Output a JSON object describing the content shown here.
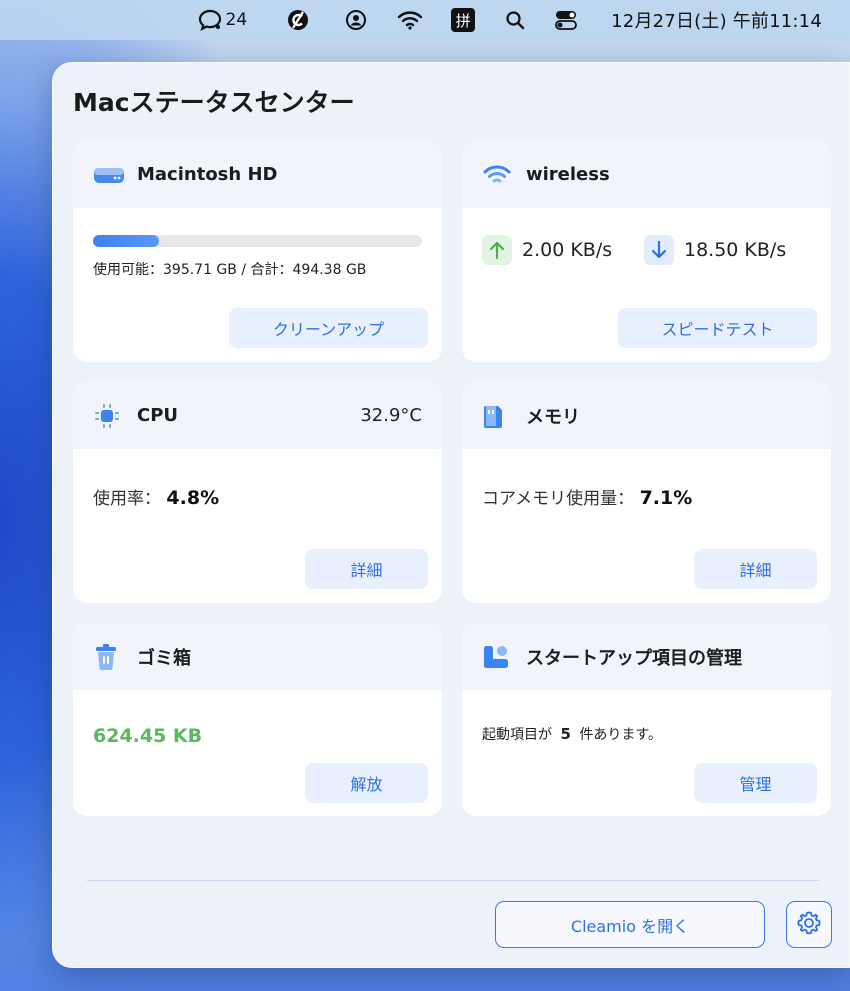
{
  "menubar": {
    "chat_count": "24",
    "input_method": "拼",
    "clock": "12月27日(土) 午前11:14"
  },
  "panel": {
    "title": "Macステータスセンター"
  },
  "disk": {
    "name": "Macintosh HD",
    "usage_text": "使用可能：395.71 GB / 合計：494.38 GB",
    "used_fraction": 0.2,
    "button": "クリーンアップ"
  },
  "network": {
    "name": "wireless",
    "upload": "2.00 KB/s",
    "download": "18.50 KB/s",
    "button": "スピードテスト"
  },
  "cpu": {
    "name": "CPU",
    "temperature": "32.9°C",
    "usage_label": "使用率：",
    "usage_value": "4.8%",
    "button": "詳細"
  },
  "memory": {
    "name": "メモリ",
    "usage_label": "コアメモリ使用量：",
    "usage_value": "7.1%",
    "button": "詳細"
  },
  "trash": {
    "name": "ゴミ箱",
    "size": "624.45  KB",
    "button": "解放"
  },
  "startup": {
    "name": "スタートアップ項目の管理",
    "text_prefix": "起動項目が",
    "count": "5",
    "text_suffix": "件あります。",
    "button": "管理"
  },
  "footer": {
    "open_button": "Cleamio を開く"
  },
  "colors": {
    "accent": "#2f6fe6",
    "trash_green": "#5cb85c",
    "upload_green": "#4caf50",
    "download_blue": "#2f6fe6"
  }
}
